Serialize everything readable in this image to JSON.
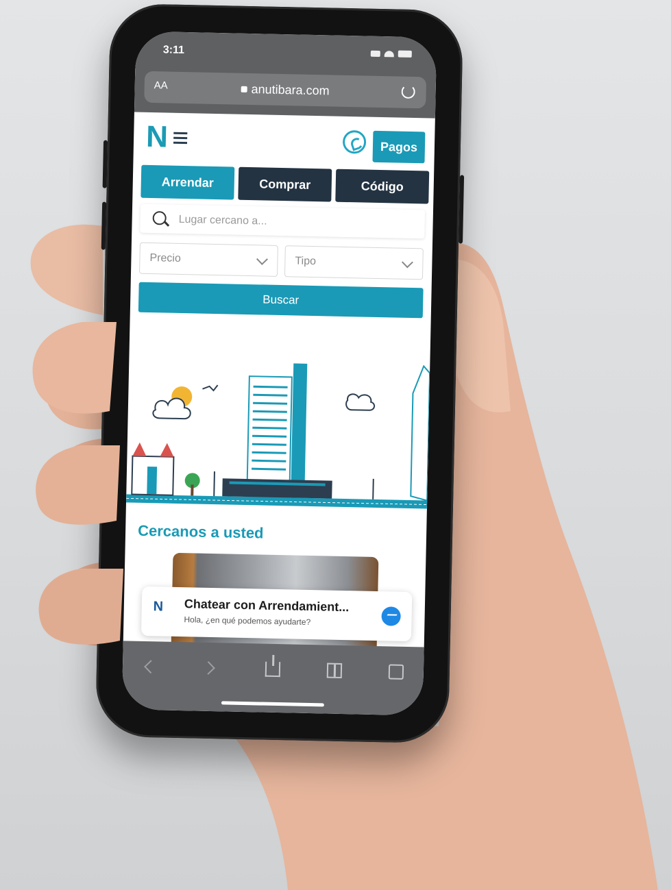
{
  "status": {
    "time": "3:11"
  },
  "browser": {
    "text_size": "AA",
    "url": "anutibara.com"
  },
  "header": {
    "logo": "N",
    "pagos_label": "Pagos"
  },
  "tabs": [
    {
      "label": "Arrendar",
      "active": true
    },
    {
      "label": "Comprar",
      "active": false
    },
    {
      "label": "Código",
      "active": false
    }
  ],
  "search": {
    "placeholder": "Lugar cercano a..."
  },
  "filters": {
    "precio": "Precio",
    "tipo": "Tipo"
  },
  "buscar_label": "Buscar",
  "section": {
    "title": "Cercanos a usted"
  },
  "chat": {
    "logo": "N",
    "title": "Chatear con Arrendamient...",
    "subtitle": "Hola, ¿en qué podemos ayudarte?"
  },
  "colors": {
    "accent": "#1a9ab6",
    "dark": "#233342"
  },
  "icons": [
    "lock-icon",
    "reload-icon",
    "whatsapp-icon",
    "search-icon",
    "chevron-down-icon",
    "messenger-icon",
    "back-icon",
    "forward-icon",
    "share-icon",
    "bookmarks-icon",
    "tabs-icon"
  ]
}
